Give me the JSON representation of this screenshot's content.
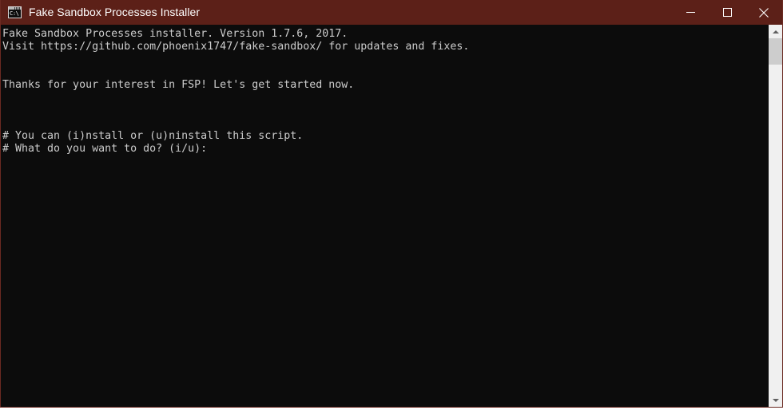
{
  "window": {
    "title": "Fake Sandbox Processes Installer",
    "icon": "cmd-console-icon",
    "icon_glyph": "C:\\.",
    "colors": {
      "titlebar_bg": "#5c2018",
      "titlebar_text": "#ffffff",
      "console_bg": "#0c0c0c",
      "console_text": "#cccccc",
      "border": "#6b2a22",
      "scrollbar_track": "#f0f0f0",
      "scrollbar_thumb": "#cdcdcd"
    },
    "controls": {
      "minimize": "minimize",
      "maximize": "maximize",
      "close": "close"
    }
  },
  "console": {
    "lines": [
      "Fake Sandbox Processes installer. Version 1.7.6, 2017.",
      "Visit https://github.com/phoenix1747/fake-sandbox/ for updates and fixes.",
      "",
      "",
      "Thanks for your interest in FSP! Let's get started now.",
      "",
      "",
      "",
      "# You can (i)nstall or (u)ninstall this script.",
      "# What do you want to do? (i/u):"
    ]
  },
  "scrollbar": {
    "up_arrow": "scroll-up",
    "down_arrow": "scroll-down",
    "thumb_position_pct": 0,
    "thumb_size_px": 33
  }
}
